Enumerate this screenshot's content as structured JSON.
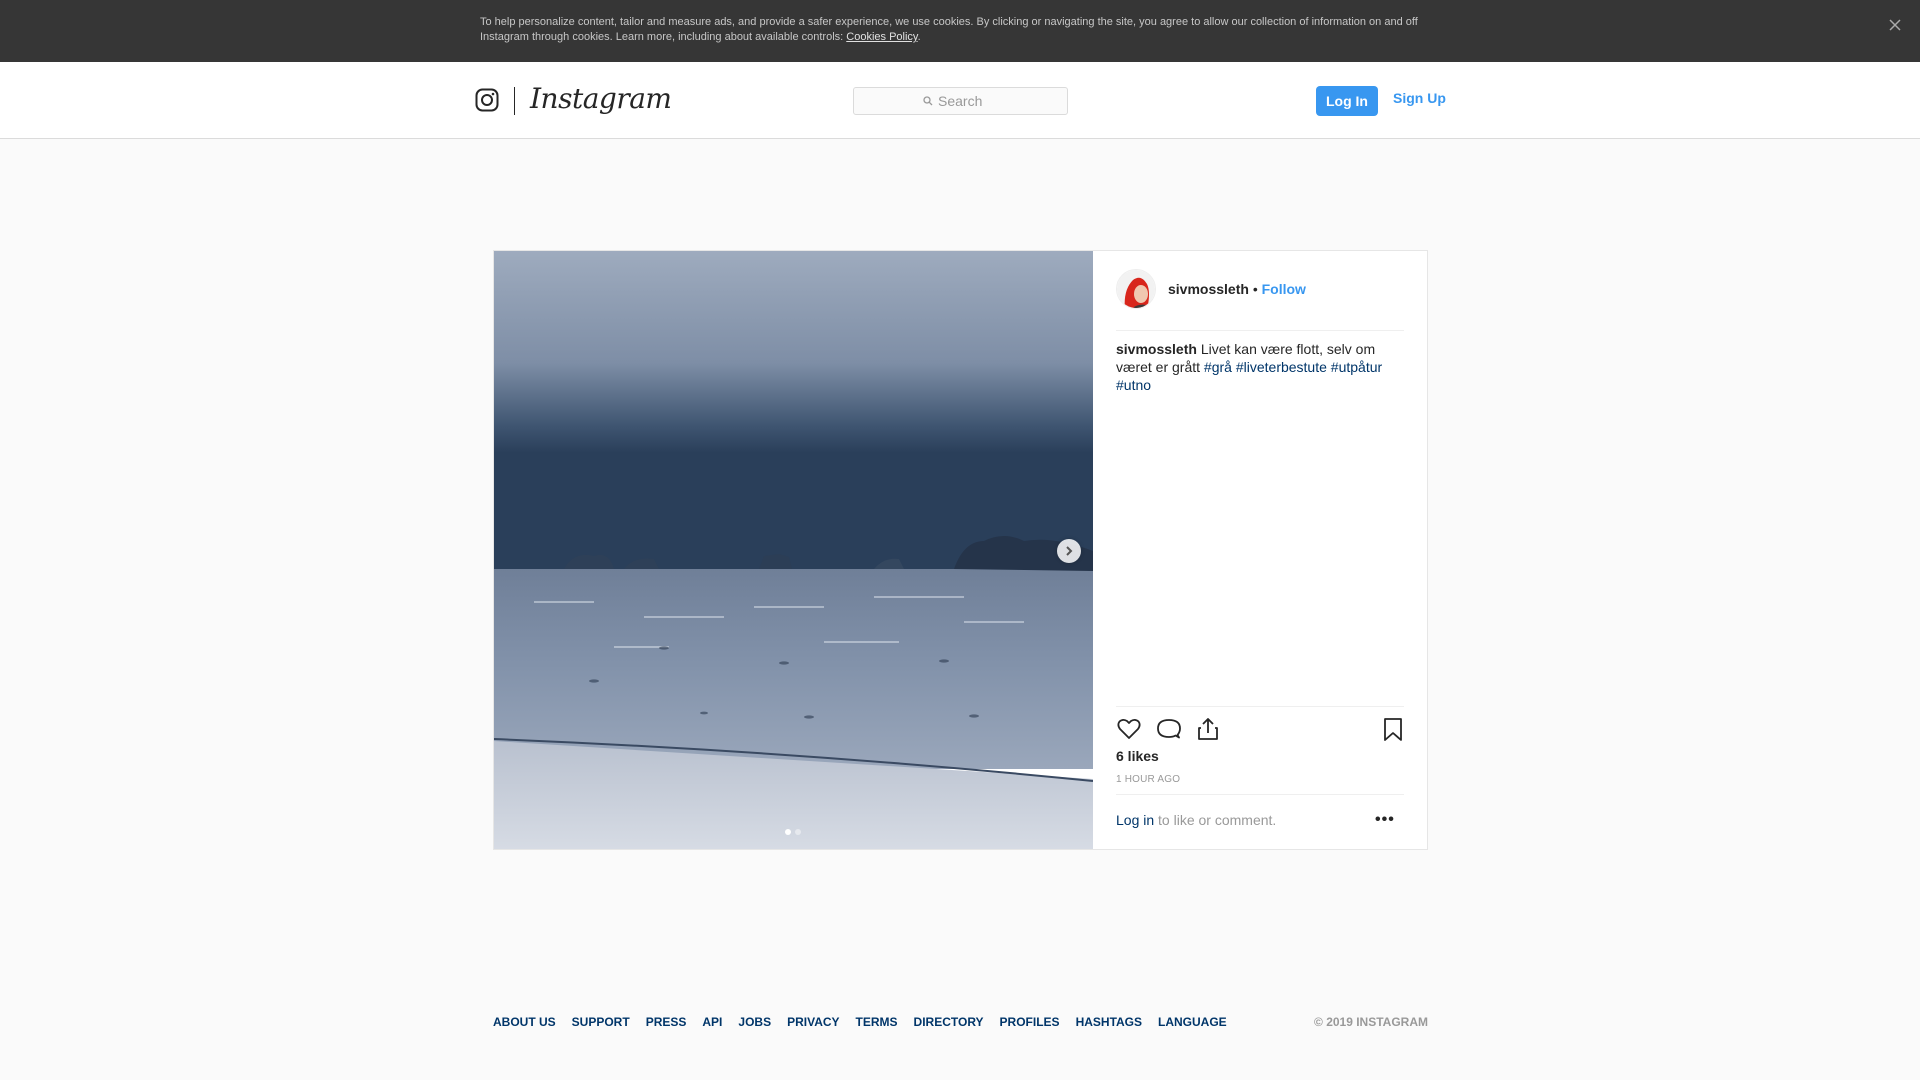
{
  "cookie_banner": {
    "text": "To help personalize content, tailor and measure ads, and provide a safer experience, we use cookies. By clicking or navigating the site, you agree to allow our collection of information on and off Instagram through cookies. Learn more, including about available controls: ",
    "link_label": "Cookies Policy",
    "trailing": ".",
    "close_icon": "close-icon"
  },
  "header": {
    "logo_icon": "instagram-glyph-icon",
    "wordmark": "Instagram",
    "search_placeholder": "Search",
    "login_label": "Log In",
    "signup_label": "Sign Up"
  },
  "post": {
    "username": "sivmossleth",
    "bullet": "•",
    "follow_label": "Follow",
    "caption_user": "sivmossleth",
    "caption_text": "Livet kan være flott, selv om været er grått",
    "hashtags": [
      "#grå",
      "#liveterbestute",
      "#utpåtur",
      "#utno"
    ],
    "likes": "6 likes",
    "time_ago": "1 HOUR AGO",
    "login_link": "Log in",
    "comment_prompt": "to like or comment.",
    "more_label": "•••",
    "carousel": {
      "total": 2,
      "current": 1
    },
    "icons": [
      "heart-icon",
      "comment-icon",
      "share-icon",
      "bookmark-icon"
    ]
  },
  "footer": {
    "links": [
      "ABOUT US",
      "SUPPORT",
      "PRESS",
      "API",
      "JOBS",
      "PRIVACY",
      "TERMS",
      "DIRECTORY",
      "PROFILES",
      "HASHTAGS",
      "LANGUAGE"
    ],
    "copyright": "© 2019 INSTAGRAM"
  },
  "colors": {
    "accent": "#3897f0",
    "link": "#003569",
    "banner_bg": "#363636"
  }
}
